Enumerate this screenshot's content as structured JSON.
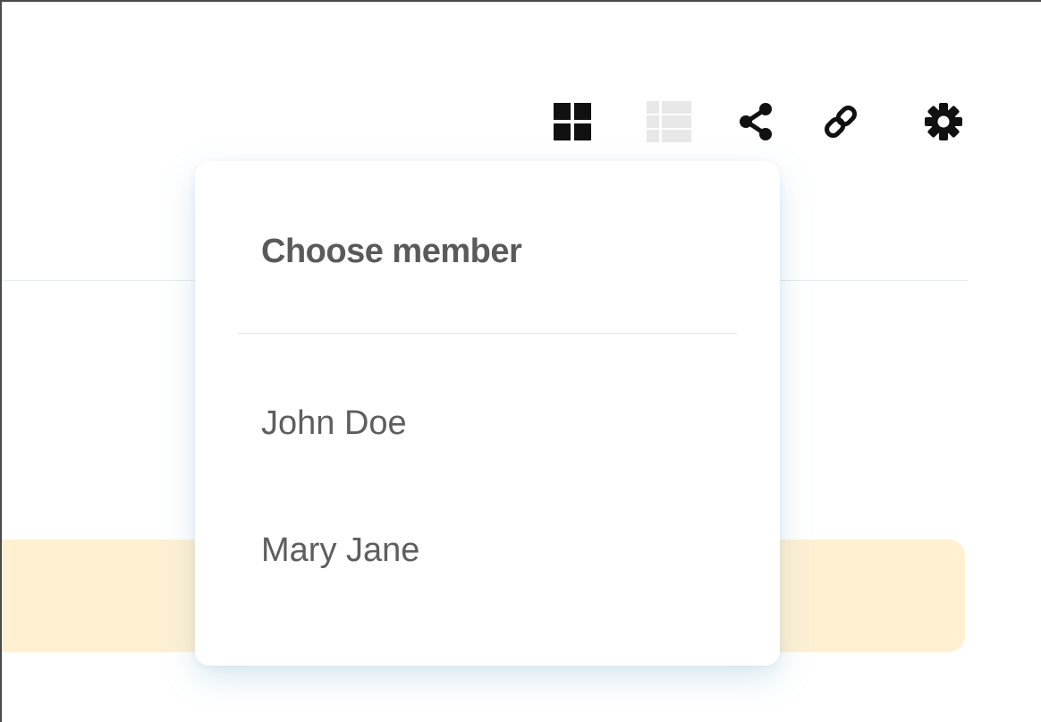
{
  "toolbar": {
    "tools": [
      {
        "icon": "grid-view-icon",
        "active": true
      },
      {
        "icon": "list-view-icon",
        "active": false
      },
      {
        "icon": "share-icon",
        "active": true
      },
      {
        "icon": "link-icon",
        "active": true
      },
      {
        "icon": "gear-icon",
        "active": true
      }
    ]
  },
  "member_menu": {
    "title": "Choose member",
    "members": [
      {
        "label": "John Doe"
      },
      {
        "label": "Mary Jane"
      }
    ]
  },
  "colors": {
    "icon": "#111111",
    "icon_disabled": "#e6e6e6",
    "banner": "#fff0d2",
    "menu_text": "#5e5e5e"
  }
}
